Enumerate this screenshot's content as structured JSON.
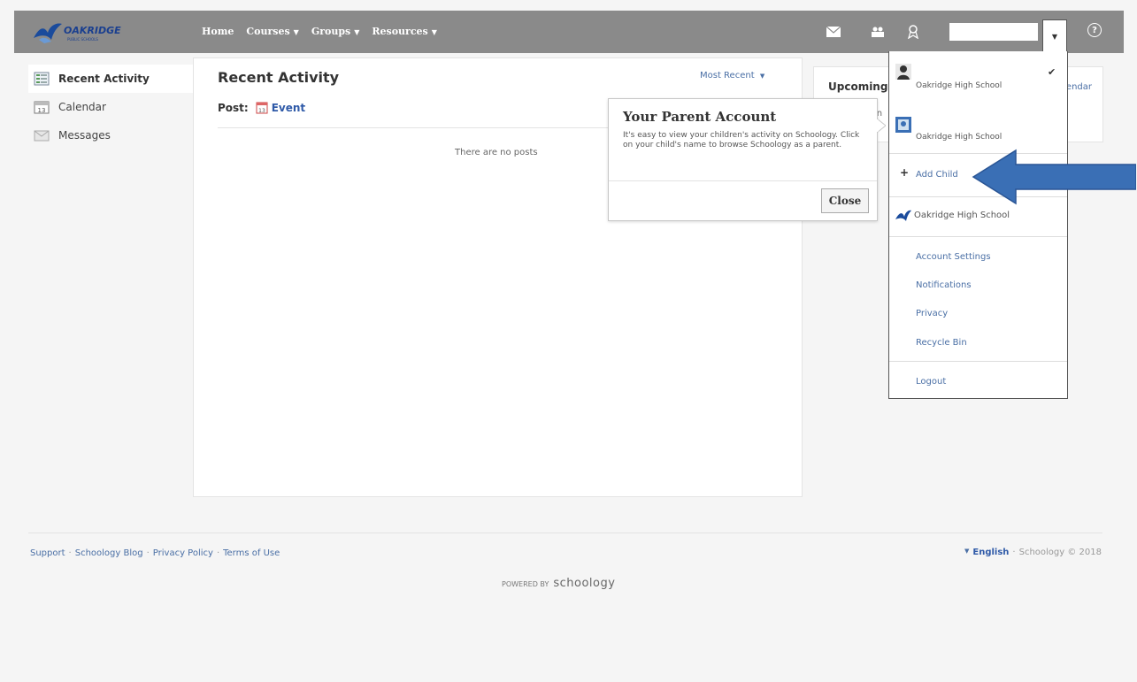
{
  "header": {
    "logo_text": "OAKRIDGE",
    "logo_subtext": "PUBLIC SCHOOLS",
    "nav": [
      {
        "label": "Home",
        "has_menu": false
      },
      {
        "label": "Courses",
        "has_menu": true
      },
      {
        "label": "Groups",
        "has_menu": true
      },
      {
        "label": "Resources",
        "has_menu": true
      }
    ],
    "caret": "▼",
    "icons": [
      "mail-icon",
      "people-icon",
      "badge-icon",
      "help-icon"
    ],
    "help_glyph": "?"
  },
  "sidebar": {
    "items": [
      {
        "label": "Recent Activity",
        "active": true,
        "icon": "activity-icon"
      },
      {
        "label": "Calendar",
        "active": false,
        "icon": "calendar-icon"
      },
      {
        "label": "Messages",
        "active": false,
        "icon": "messages-icon"
      }
    ]
  },
  "main": {
    "title": "Recent Activity",
    "sort_label": "Most Recent",
    "post_label": "Post:",
    "post_event": "Event",
    "empty_text": "There are no posts"
  },
  "upcoming": {
    "title": "Upcoming",
    "calendar_link": "Calendar",
    "sub_fragment": "in"
  },
  "popover": {
    "title": "Your Parent Account",
    "body": "It's easy to view your children's activity on Schoology. Click on your child's name to browse Schoology as a parent.",
    "close_label": "Close"
  },
  "dropdown": {
    "accounts": [
      {
        "school": "Oakridge High School",
        "selected": true,
        "icon": "person-icon"
      },
      {
        "school": "Oakridge High School",
        "selected": false,
        "icon": "child-photo-icon"
      }
    ],
    "add_child_label": "Add Child",
    "org_label": "Oakridge High School",
    "links": [
      "Account Settings",
      "Notifications",
      "Privacy",
      "Recycle Bin"
    ],
    "logout_label": "Logout",
    "check": "✔"
  },
  "footer": {
    "links": [
      "Support",
      "Schoology Blog",
      "Privacy Policy",
      "Terms of Use"
    ],
    "separator": "·",
    "language": "English",
    "copyright": "Schoology © 2018",
    "powered_by": "POWERED BY",
    "powered_brand": "schoology"
  },
  "colors": {
    "topbar": "#8a8a8a",
    "link": "#4a6fa5",
    "arrow": "#3a6fb5"
  }
}
